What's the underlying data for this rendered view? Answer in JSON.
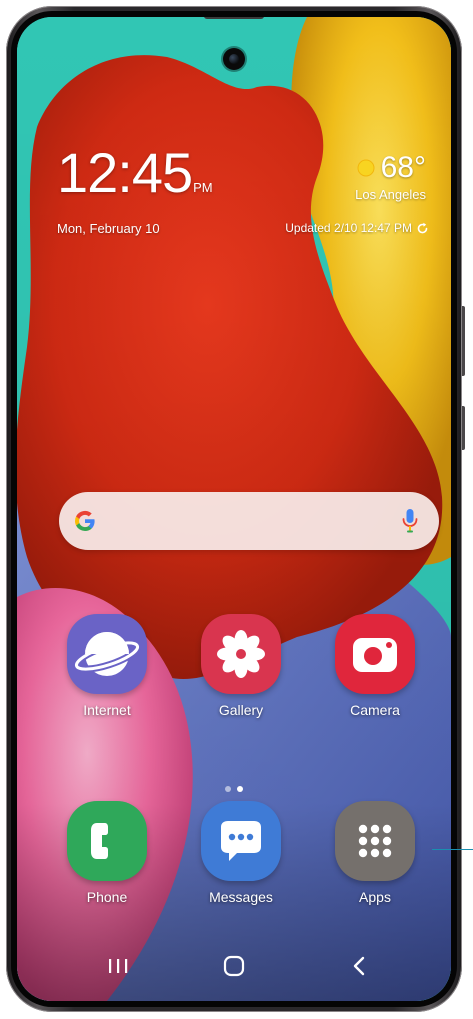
{
  "colors": {
    "wallpaper_teal": "#31c6b4",
    "balloon_red": "#d12a14",
    "balloon_yellow": "#f2c31b",
    "fur_pink": "#f06aa0",
    "wallpaper_blue": "#5e74c4",
    "callout_blue": "#1a8fb0"
  },
  "clock": {
    "time": "12:45",
    "ampm": "PM",
    "date": "Mon, February 10"
  },
  "weather": {
    "icon": "sun-icon",
    "temperature": "68°",
    "city": "Los Angeles",
    "updated": "Updated 2/10 12:47 PM",
    "refresh_icon": "refresh-icon"
  },
  "search": {
    "logo_icon": "google-g-icon",
    "mic_icon": "microphone-icon"
  },
  "home_apps": [
    {
      "label": "Internet",
      "icon": "internet-planet-icon",
      "color": "#6a63c6"
    },
    {
      "label": "Gallery",
      "icon": "gallery-flower-icon",
      "color": "#d9354f"
    },
    {
      "label": "Camera",
      "icon": "camera-icon",
      "color": "#e0263c"
    }
  ],
  "page_indicator": {
    "count": 2,
    "active": 1
  },
  "dock_apps": [
    {
      "label": "Phone",
      "icon": "phone-handset-icon",
      "color": "#2fa85a"
    },
    {
      "label": "Messages",
      "icon": "messages-bubble-icon",
      "color": "#3f7bd6"
    },
    {
      "label": "Apps",
      "icon": "apps-grid-icon",
      "color": "#75706c"
    }
  ],
  "navigation": {
    "recents_icon": "recents-icon",
    "home_icon": "home-icon",
    "back_icon": "back-icon"
  }
}
